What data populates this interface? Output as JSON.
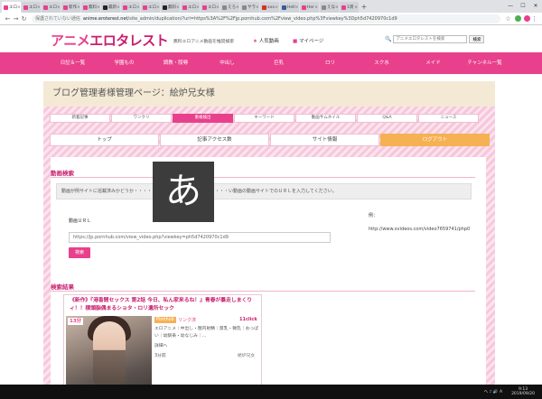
{
  "browser": {
    "tabs": [
      {
        "title": "エロ",
        "icon": "site",
        "active": true
      },
      {
        "title": "エロ",
        "icon": "site",
        "active": false
      },
      {
        "title": "エロ",
        "icon": "site",
        "active": false
      },
      {
        "title": "新作",
        "icon": "site",
        "active": false
      },
      {
        "title": "無料",
        "icon": "site",
        "active": false
      },
      {
        "title": "最新",
        "icon": "ph",
        "active": false
      },
      {
        "title": "エロ",
        "icon": "site",
        "active": false
      },
      {
        "title": "エロ",
        "icon": "site",
        "active": false
      },
      {
        "title": "無料",
        "icon": "ph",
        "active": false
      },
      {
        "title": "エロ",
        "icon": "site",
        "active": false
      },
      {
        "title": "エロ",
        "icon": "site",
        "active": false
      },
      {
        "title": "えろ",
        "icon": "gray",
        "active": false
      },
      {
        "title": "サラ",
        "icon": "gray",
        "active": false
      },
      {
        "title": "xxx",
        "icon": "yt",
        "active": false
      },
      {
        "title": "Hell",
        "icon": "fb",
        "active": false
      },
      {
        "title": "Her",
        "icon": "site",
        "active": false
      },
      {
        "title": "えな",
        "icon": "gray",
        "active": false
      },
      {
        "title": "1周",
        "icon": "site",
        "active": false
      }
    ],
    "security_label": "保護されていない通信",
    "url_host": "anime.eroterest.net",
    "url_path": "/site_admin/duplication/?url=https%3A%2F%2Fjp.pornhub.com%2Fview_video.php%3Fviewkey%3Dph5d7420970c1d9",
    "new_tab": "+",
    "window_controls": [
      "—",
      "☐",
      "✕"
    ]
  },
  "site": {
    "logo_main": "アニメ",
    "logo_sub": "エロタレスト",
    "tagline": "無料エロアニメ動画を推奨検索",
    "popular_label": "人気動画",
    "mypage_label": "マイページ",
    "search_placeholder": "アニメエロタレストを検索",
    "search_button": "検索"
  },
  "main_nav": [
    "日記＆一覧",
    "学園もの",
    "調教・陵辱",
    "中出し",
    "巨乳",
    "ロリ",
    "スク水",
    "メイド",
    "チャンネル一覧"
  ],
  "admin": {
    "title": "ブログ管理者様管理ページ：絵炉兄女様",
    "tabs_row1": [
      {
        "label": "新着記事",
        "active": false
      },
      {
        "label": "ワンクリ",
        "active": false
      },
      {
        "label": "重複検出",
        "active": true
      },
      {
        "label": "キーワード",
        "active": false
      },
      {
        "label": "動画サムネイル",
        "active": false
      },
      {
        "label": "Q&A",
        "active": false
      },
      {
        "label": "ニュース",
        "active": false
      }
    ],
    "tabs_row2": [
      {
        "label": "トップ",
        "active": false
      },
      {
        "label": "記事アクセス数",
        "active": false
      },
      {
        "label": "サイト情報",
        "active": false
      },
      {
        "label": "ログアウト",
        "active": true
      }
    ]
  },
  "video_search": {
    "section_title": "動画検索",
    "notice": "動画が例サイトに巡載済みかどうか・・・・・・・・・・・・・・・・・・・・・い動画の動画サイトでのＵＲＬを入力してください。",
    "url_label": "動画ＵＲＬ",
    "url_value": "https://jp.pornhub.com/view_video.php?viewkey=ph5d7420970c1d9",
    "search_button": "検索",
    "example_label": "例：",
    "example_url": "http://www.xvideos.com/video7659741/php0"
  },
  "results": {
    "section_title": "検索結果",
    "items": [
      {
        "title": "《新作》『港香間セックス 第2話 今日、私ん家来るね！』青春が暴走しまくりィ！！積頭脳偶まるショタ・ロリ遺所セック",
        "duration": "13分",
        "site_tag": "Pornhub",
        "status": "リンク済",
        "clicks": "11click",
        "tags": "エロアニメ｜中出し・膣内射精｜貧乳・微乳｜おっぱい｜幼馴染・幼なじみ｜...",
        "more_label": "詳細へ",
        "minutes_ago": "3分前",
        "user": "絵炉兄女"
      }
    ]
  },
  "ime": {
    "char": "あ"
  },
  "taskbar": {
    "tray": "へ ♪ 🔊 A",
    "time": "9:13",
    "date": "2019/09/20"
  }
}
